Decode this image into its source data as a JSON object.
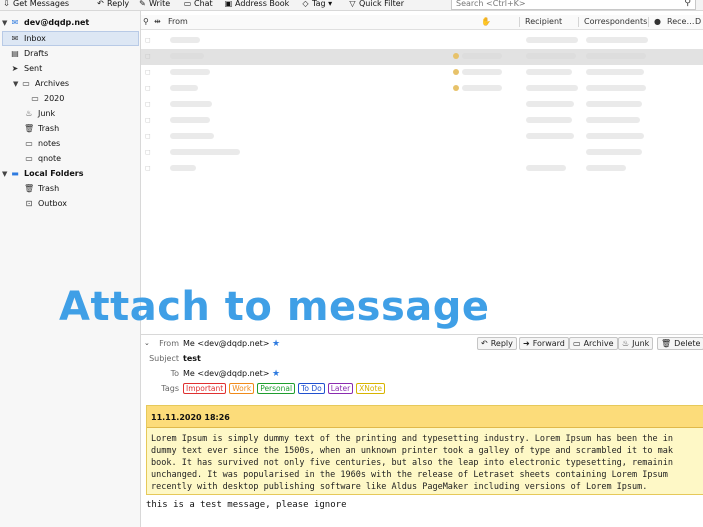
{
  "toolbar": {
    "get_messages": "Get Messages",
    "reply": "Reply",
    "chat": "Chat",
    "write": "Write",
    "address_book": "Address Book",
    "tag": "Tag",
    "quick_filter": "Quick Filter",
    "search_placeholder": "Search <Ctrl+K>"
  },
  "sidebar": {
    "account": "dev@dqdp.net",
    "folders": [
      "Inbox",
      "Drafts",
      "Sent",
      "Archives",
      "2020",
      "Junk",
      "Trash",
      "notes",
      "qnote"
    ],
    "local_folders": "Local Folders",
    "local_items": [
      "Trash",
      "Outbox"
    ]
  },
  "thread": {
    "columns": {
      "from": "From",
      "recipient": "Recipient",
      "correspondents": "Correspondents",
      "received": "Rece…",
      "date": "D"
    },
    "row_count": 9,
    "selected_row": 1
  },
  "overlay": {
    "text": "Attach to message"
  },
  "message": {
    "from_label": "From",
    "from_value": "Me <dev@dqdp.net>",
    "subject_label": "Subject",
    "subject_value": "test",
    "to_label": "To",
    "to_value": "Me <dev@dqdp.net>",
    "tags_label": "Tags",
    "tags": [
      {
        "label": "Important",
        "color": "#e03030"
      },
      {
        "label": "Work",
        "color": "#f08a1a"
      },
      {
        "label": "Personal",
        "color": "#1e9e2e"
      },
      {
        "label": "To Do",
        "color": "#2050d0"
      },
      {
        "label": "Later",
        "color": "#8a2bb0"
      },
      {
        "label": "XNote",
        "color": "#d7b400"
      }
    ],
    "buttons": [
      "Reply",
      "Forward",
      "Archive",
      "Junk",
      "Delete"
    ]
  },
  "note": {
    "date": "11.11.2020 18:26",
    "lines": [
      "Lorem Ipsum is simply dummy text of the printing and typesetting industry. Lorem Ipsum has been the in",
      "dummy text ever since the 1500s, when an unknown printer took a galley of type and scrambled it to mak",
      "book. It has survived not only five centuries, but also the leap into electronic typesetting, remainin",
      "unchanged. It was popularised in the 1960s with the release of Letraset sheets containing Lorem Ipsum ",
      "recently with desktop publishing software like Aldus PageMaker including versions of Lorem Ipsum."
    ]
  },
  "body_text": "this is a test message, please ignore",
  "colors": {
    "accent": "#3f9fe6",
    "selection": "#dde7f4",
    "note_bg": "#fef8c6",
    "note_head": "#fcdc7a"
  }
}
